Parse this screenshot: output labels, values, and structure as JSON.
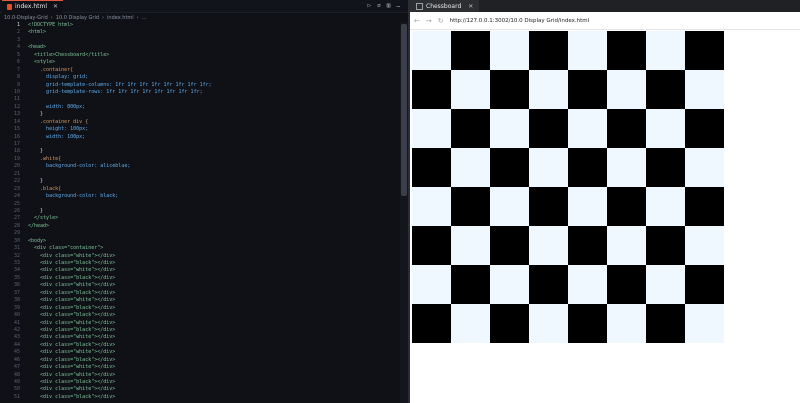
{
  "editor": {
    "tab_label": "index.html",
    "breadcrumb": [
      "10.0-Display-Grid",
      "10.0 Display Grid",
      "index.html",
      "..."
    ],
    "code_lines": [
      {
        "n": "1",
        "t": "<!DOCTYPE html>"
      },
      {
        "n": "2",
        "t": "<html>"
      },
      {
        "n": "3",
        "t": ""
      },
      {
        "n": "4",
        "t": "<head>"
      },
      {
        "n": "5",
        "t": "  <title>Chessboard</title>"
      },
      {
        "n": "6",
        "t": "  <style>"
      },
      {
        "n": "7",
        "t": "    .container{"
      },
      {
        "n": "8",
        "t": "      display: grid;"
      },
      {
        "n": "9",
        "t": "      grid-template-columns: 1fr 1fr 1fr 1fr 1fr 1fr 1fr 1fr;"
      },
      {
        "n": "10",
        "t": "      grid-template-rows: 1fr 1fr 1fr 1fr 1fr 1fr 1fr 1fr;"
      },
      {
        "n": "11",
        "t": ""
      },
      {
        "n": "12",
        "t": "      width: 800px;"
      },
      {
        "n": "13",
        "t": "    }"
      },
      {
        "n": "14",
        "t": "    .container div {"
      },
      {
        "n": "15",
        "t": "      height: 100px;"
      },
      {
        "n": "16",
        "t": "      width: 100px;"
      },
      {
        "n": "17",
        "t": ""
      },
      {
        "n": "18",
        "t": "    }"
      },
      {
        "n": "19",
        "t": "    .white{"
      },
      {
        "n": "20",
        "t": "      background-color: aliceblue;"
      },
      {
        "n": "21",
        "t": ""
      },
      {
        "n": "22",
        "t": "    }"
      },
      {
        "n": "23",
        "t": "    .black{"
      },
      {
        "n": "24",
        "t": "      background-color: black;"
      },
      {
        "n": "25",
        "t": ""
      },
      {
        "n": "26",
        "t": "    }"
      },
      {
        "n": "27",
        "t": "  </style>"
      },
      {
        "n": "28",
        "t": "</head>"
      },
      {
        "n": "29",
        "t": ""
      },
      {
        "n": "30",
        "t": "<body>"
      },
      {
        "n": "31",
        "t": "  <div class=\"container\">"
      },
      {
        "n": "32",
        "t": "    <div class=\"white\"></div>"
      },
      {
        "n": "33",
        "t": "    <div class=\"black\"></div>"
      },
      {
        "n": "34",
        "t": "    <div class=\"white\"></div>"
      },
      {
        "n": "35",
        "t": "    <div class=\"black\"></div>"
      },
      {
        "n": "36",
        "t": "    <div class=\"white\"></div>"
      },
      {
        "n": "37",
        "t": "    <div class=\"black\"></div>"
      },
      {
        "n": "38",
        "t": "    <div class=\"white\"></div>"
      },
      {
        "n": "39",
        "t": "    <div class=\"black\"></div>"
      },
      {
        "n": "40",
        "t": "    <div class=\"black\"></div>"
      },
      {
        "n": "41",
        "t": "    <div class=\"white\"></div>"
      },
      {
        "n": "42",
        "t": "    <div class=\"black\"></div>"
      },
      {
        "n": "43",
        "t": "    <div class=\"white\"></div>"
      },
      {
        "n": "44",
        "t": "    <div class=\"black\"></div>"
      },
      {
        "n": "45",
        "t": "    <div class=\"white\"></div>"
      },
      {
        "n": "46",
        "t": "    <div class=\"black\"></div>"
      },
      {
        "n": "47",
        "t": "    <div class=\"white\"></div>"
      },
      {
        "n": "48",
        "t": "    <div class=\"white\"></div>"
      },
      {
        "n": "49",
        "t": "    <div class=\"black\"></div>"
      },
      {
        "n": "50",
        "t": "    <div class=\"white\"></div>"
      },
      {
        "n": "51",
        "t": "    <div class=\"black\"></div>"
      }
    ]
  },
  "browser": {
    "tab_title": "Chessboard",
    "url": "http://127.0.0.1:3002/10.0 Display Grid/index.html",
    "board": {
      "colors": {
        "white": "#f0f8ff",
        "black": "#000000"
      },
      "rows": [
        [
          "white",
          "black",
          "white",
          "black",
          "white",
          "black",
          "white",
          "black"
        ],
        [
          "black",
          "white",
          "black",
          "white",
          "black",
          "white",
          "black",
          "white"
        ],
        [
          "white",
          "black",
          "white",
          "black",
          "white",
          "black",
          "white",
          "black"
        ],
        [
          "black",
          "white",
          "black",
          "white",
          "black",
          "white",
          "black",
          "white"
        ],
        [
          "white",
          "black",
          "white",
          "black",
          "white",
          "black",
          "white",
          "black"
        ],
        [
          "black",
          "white",
          "black",
          "white",
          "black",
          "white",
          "black",
          "white"
        ],
        [
          "white",
          "black",
          "white",
          "black",
          "white",
          "black",
          "white",
          "black"
        ],
        [
          "black",
          "white",
          "black",
          "white",
          "black",
          "white",
          "black",
          "white"
        ]
      ]
    }
  }
}
